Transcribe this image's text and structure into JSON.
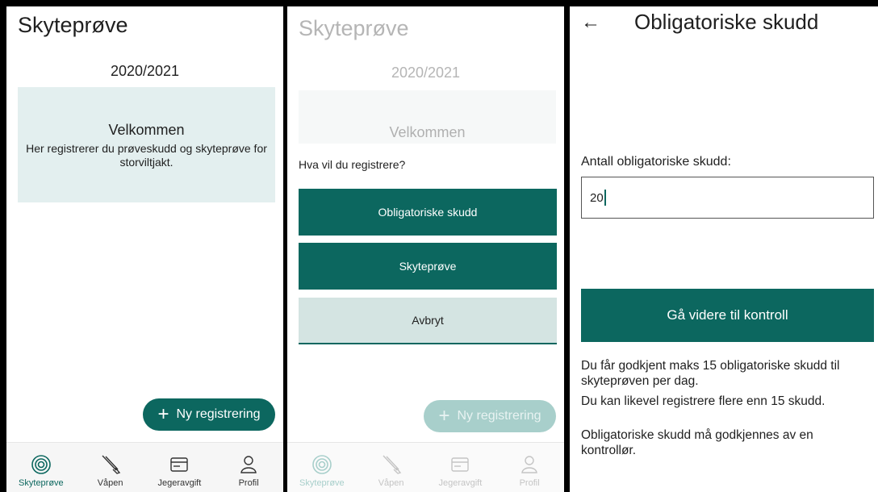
{
  "panel1": {
    "title": "Skyteprøve",
    "season": "2020/2021",
    "welcome_title": "Velkommen",
    "welcome_text": "Her registrerer du prøveskudd og skyteprøve for storviltjakt.",
    "fab_label": "Ny registrering",
    "fab_icon": "+"
  },
  "panel2": {
    "title": "Skyteprøve",
    "season": "2020/2021",
    "welcome_title": "Velkommen",
    "question": "Hva vil du registrere?",
    "options": [
      "Obligatoriske skudd",
      "Skyteprøve"
    ],
    "cancel_label": "Avbryt",
    "fab_label": "Ny registrering",
    "fab_icon": "+"
  },
  "nav": [
    {
      "label": "Skyteprøve",
      "icon": "target-icon"
    },
    {
      "label": "Våpen",
      "icon": "rifle-icon"
    },
    {
      "label": "Jegeravgift",
      "icon": "card-icon"
    },
    {
      "label": "Profil",
      "icon": "person-icon"
    }
  ],
  "panel3": {
    "back_icon": "←",
    "title": "Obligatoriske skudd",
    "field_label": "Antall obligatoriske skudd:",
    "field_value": "20",
    "continue_label": "Gå videre til kontroll",
    "info1": "Du får godkjent maks 15 obligatoriske skudd til skyteprøven per dag.",
    "info2": "Du kan likevel registrere flere enn 15 skudd.",
    "info3": "Obligatoriske skudd må godkjennes av en kontrollør."
  },
  "colors": {
    "primary": "#0c675f",
    "welcome_bg": "#e3efef",
    "cancel_bg": "#d4e4e2"
  }
}
